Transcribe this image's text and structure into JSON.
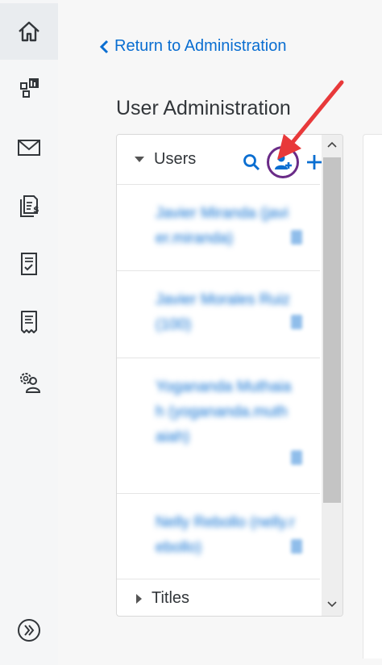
{
  "nav": {
    "items": [
      {
        "name": "home-icon",
        "active": true
      },
      {
        "name": "dashboard-icon",
        "active": false
      },
      {
        "name": "mail-icon",
        "active": false
      },
      {
        "name": "expense-report-icon",
        "active": false
      },
      {
        "name": "checklist-icon",
        "active": false
      },
      {
        "name": "receipt-icon",
        "active": false
      },
      {
        "name": "user-settings-icon",
        "active": false
      }
    ],
    "expand_icon": "double-chevron-right-icon"
  },
  "header": {
    "back_link": "Return to Administration",
    "title": "User Administration"
  },
  "panel": {
    "group_title": "Users",
    "footer_group_title": "Titles",
    "actions": [
      "search-icon",
      "add-user-icon",
      "add-icon"
    ],
    "users": [
      {
        "text": "Javier Miranda (javier.miranda)"
      },
      {
        "text": "Javier Morales Ruiz (100)"
      },
      {
        "text": "Yogananda Muthaiah (yogananda.muthaiah)"
      },
      {
        "text": "Nelly Rebollo (nelly.rebollo)"
      }
    ]
  },
  "colors": {
    "accent": "#0a6ed1",
    "highlight_circle": "#6a2b87",
    "annotation_arrow": "#e8393a"
  }
}
